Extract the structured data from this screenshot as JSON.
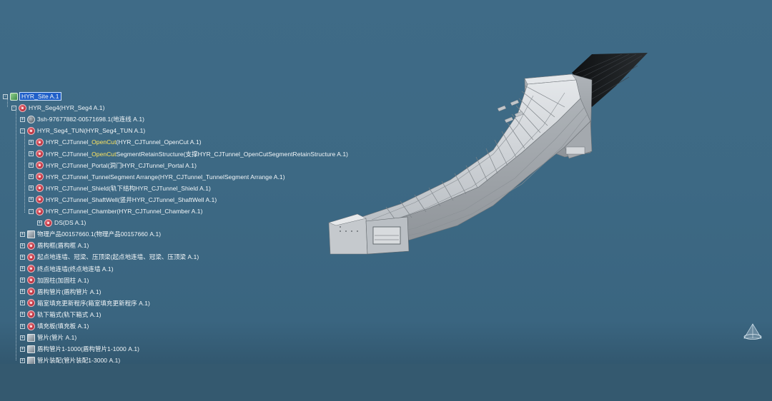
{
  "tree": {
    "items": [
      {
        "label": "HYR_Site A.1",
        "icon": "site-icon",
        "expander": "-",
        "selected": true
      },
      {
        "label": "HYR_Seg4(HYR_Seg4 A.1)",
        "icon": "red-part-icon",
        "expander": "-"
      },
      {
        "label": "3sh-97677882-00571698.1(地连线 A.1)",
        "icon": "gray-part-icon",
        "expander": "+"
      },
      {
        "label": "HYR_Seg4_TUN(HYR_Seg4_TUN A.1)",
        "icon": "red-part-icon",
        "expander": "-"
      },
      {
        "label_prefix": "HYR_CJTunnel_",
        "label_hl": "OpenCut",
        "label_suffix": "(HYR_CJTunnel_OpenCut A.1)",
        "icon": "red-part-icon",
        "expander": "+"
      },
      {
        "label_prefix": "HYR_CJTunnel_",
        "label_hl": "OpenCut",
        "label_suffix": "SegmentRetainStructure(支撑HYR_CJTunnel_OpenCutSegmentRetainStructure A.1)",
        "icon": "red-part-icon",
        "expander": "+"
      },
      {
        "label": "HYR_CJTunnel_Portal(洞门HYR_CJTunnel_Portal A.1)",
        "icon": "red-part-icon",
        "expander": "+"
      },
      {
        "label": "HYR_CJTunnel_TunnelSegment Arrange(HYR_CJTunnel_TunnelSegment Arrange A.1)",
        "icon": "red-part-icon",
        "expander": "+"
      },
      {
        "label": "HYR_CJTunnel_Shield(轨下结构HYR_CJTunnel_Shield A.1)",
        "icon": "red-part-icon",
        "expander": "+"
      },
      {
        "label": "HYR_CJTunnel_ShaftWell(竖井HYR_CJTunnel_ShaftWell A.1)",
        "icon": "red-part-icon",
        "expander": "+"
      },
      {
        "label": "HYR_CJTunnel_Chamber(HYR_CJTunnel_Chamber A.1)",
        "icon": "red-part-icon",
        "expander": "-"
      },
      {
        "label": "DS(DS A.1)",
        "icon": "red-part-icon",
        "expander": "+"
      },
      {
        "label": "物理产品00157660.1(物理产品00157660 A.1)",
        "icon": "box-icon",
        "expander": "+"
      },
      {
        "label": "盾构框(盾构框 A.1)",
        "icon": "red-part-icon",
        "expander": "+"
      },
      {
        "label": "起点地连墙、冠梁、压顶梁(起点地连墙、冠梁、压顶梁 A.1)",
        "icon": "red-part-icon",
        "expander": "+"
      },
      {
        "label": "终点地连墙(终点地连墙 A.1)",
        "icon": "red-part-icon",
        "expander": "+"
      },
      {
        "label": "加固柱(加固柱 A.1)",
        "icon": "red-part-icon",
        "expander": "+"
      },
      {
        "label": "盾构管片(盾构管片 A.1)",
        "icon": "red-part-icon",
        "expander": "+"
      },
      {
        "label": "箱室填充更新程序(箱室填充更新程序 A.1)",
        "icon": "red-part-icon",
        "expander": "+"
      },
      {
        "label": "轨下箱式(轨下箱式 A.1)",
        "icon": "red-part-icon",
        "expander": "+"
      },
      {
        "label": "填充板(填充板 A.1)",
        "icon": "red-part-icon",
        "expander": "+"
      },
      {
        "label": "管片(管片 A.1)",
        "icon": "box-icon",
        "expander": "+"
      },
      {
        "label": "盾构管片1-1000(盾构管片1-1000 A.1)",
        "icon": "box-icon",
        "expander": "+"
      },
      {
        "label": "管片装配(管片装配1-3000 A.1)",
        "icon": "box-icon",
        "expander": "+"
      }
    ]
  },
  "viewport": {
    "model": "tunnel-3d-model",
    "model_color": "#c9cdd1",
    "cable_color": "#1a1d20"
  },
  "colors": {
    "background": "#3d6984",
    "selection": "#1f5fc9",
    "highlight_text": "#ffe560"
  }
}
